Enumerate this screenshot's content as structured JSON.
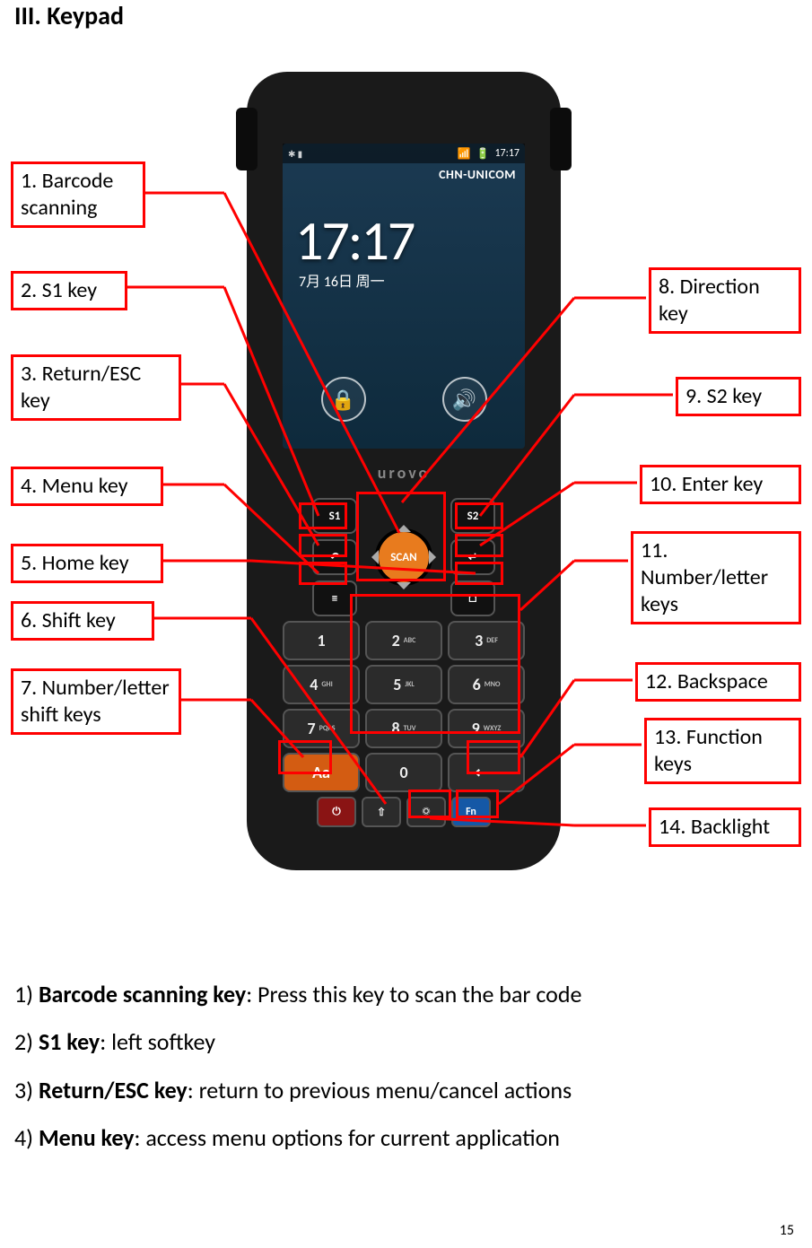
{
  "heading": "III. Keypad",
  "pageNumber": "15",
  "device": {
    "brand": "urovo",
    "statusTime": "17:17",
    "carrier": "CHN-UNICOM",
    "clock": "17:17",
    "date": "7月 16日 周一"
  },
  "keys": {
    "s1": "S1",
    "s2": "S2",
    "scan": "SCAN",
    "num1": "1",
    "num2": "2",
    "sub2": "ABC",
    "num3": "3",
    "sub3": "DEF",
    "num4": "4",
    "sub4": "GHI",
    "num5": "5",
    "sub5": "JKL",
    "num6": "6",
    "sub6": "MNO",
    "num7": "7",
    "sub7": "PQRS",
    "num8": "8",
    "sub8": "TUV",
    "num9": "9",
    "sub9": "WXYZ",
    "aa": "Aa",
    "num0": "0",
    "fn": "Fn"
  },
  "labels": {
    "l1": "1. Barcode scanning",
    "l2": "2. S1 key",
    "l3": "3. Return/ESC key",
    "l4": "4. Menu key",
    "l5": "5. Home key",
    "l6": "6. Shift key",
    "l7": "7. Number/letter shift keys",
    "l8": "8. Direction key",
    "l9": "9. S2 key",
    "l10": "10. Enter key",
    "l11": "11. Number/letter keys",
    "l12": "12. Backspace",
    "l13": "13. Function keys",
    "l14": "14. Backlight"
  },
  "desc": {
    "d1_pre": "1) ",
    "d1_b": "Barcode scanning key",
    "d1_post": ": Press this key to scan the bar code",
    "d2_pre": "2) ",
    "d2_b": "S1 key",
    "d2_post": ": left softkey",
    "d3_pre": "3) ",
    "d3_b": "Return/ESC key",
    "d3_post": ": return to previous menu/cancel actions",
    "d4_pre": "4) ",
    "d4_b": "Menu key",
    "d4_post": ": access menu options for current application"
  }
}
